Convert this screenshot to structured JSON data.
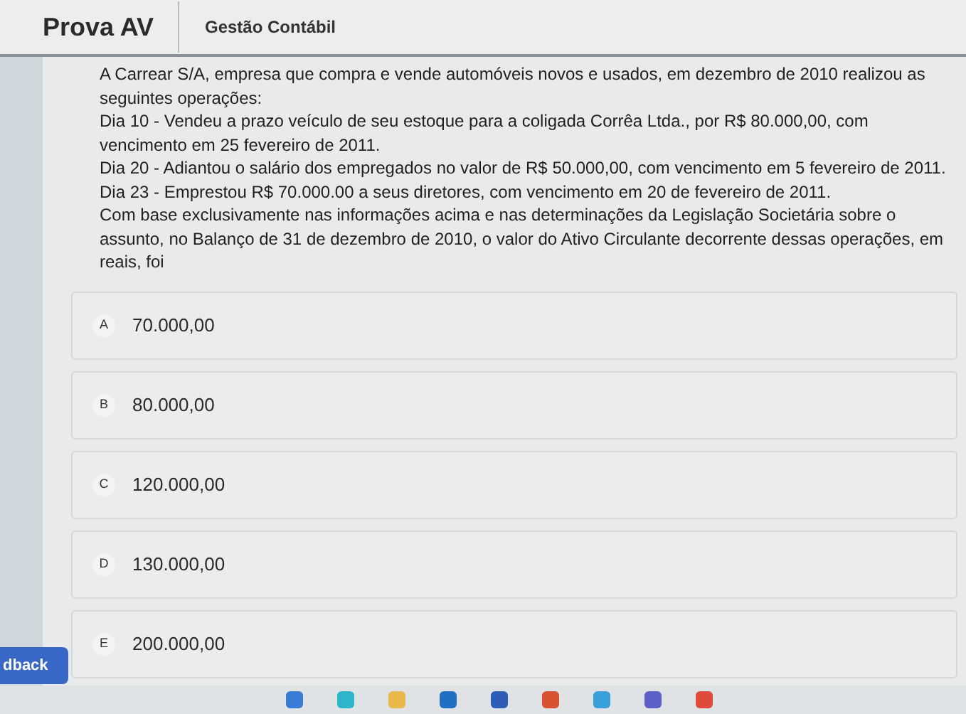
{
  "header": {
    "title": "Prova AV",
    "subject": "Gestão Contábil"
  },
  "question": {
    "paragraphs": [
      "A Carrear S/A, empresa que compra e vende automóveis novos e usados, em dezembro de 2010 realizou as seguintes operações:",
      "Dia 10 - Vendeu a prazo veículo de seu estoque para a coligada Corrêa Ltda., por R$ 80.000,00, com vencimento em 25 fevereiro de 2011.",
      "Dia 20 - Adiantou o salário dos empregados no valor de R$ 50.000,00, com vencimento em 5 fevereiro de 2011.",
      "Dia 23 - Emprestou R$ 70.000.00 a seus diretores, com vencimento em 20 de fevereiro de 2011.",
      "Com base exclusivamente nas informações acima e nas determinações da Legislação Societária sobre o assunto, no Balanço de 31 de dezembro de 2010, o valor do Ativo Circulante decorrente dessas operações, em reais, foi"
    ]
  },
  "options": [
    {
      "letter": "A",
      "text": "70.000,00"
    },
    {
      "letter": "B",
      "text": "80.000,00"
    },
    {
      "letter": "C",
      "text": "120.000,00"
    },
    {
      "letter": "D",
      "text": "130.000,00"
    },
    {
      "letter": "E",
      "text": "200.000,00"
    }
  ],
  "feedback_button": {
    "label": "dback"
  }
}
